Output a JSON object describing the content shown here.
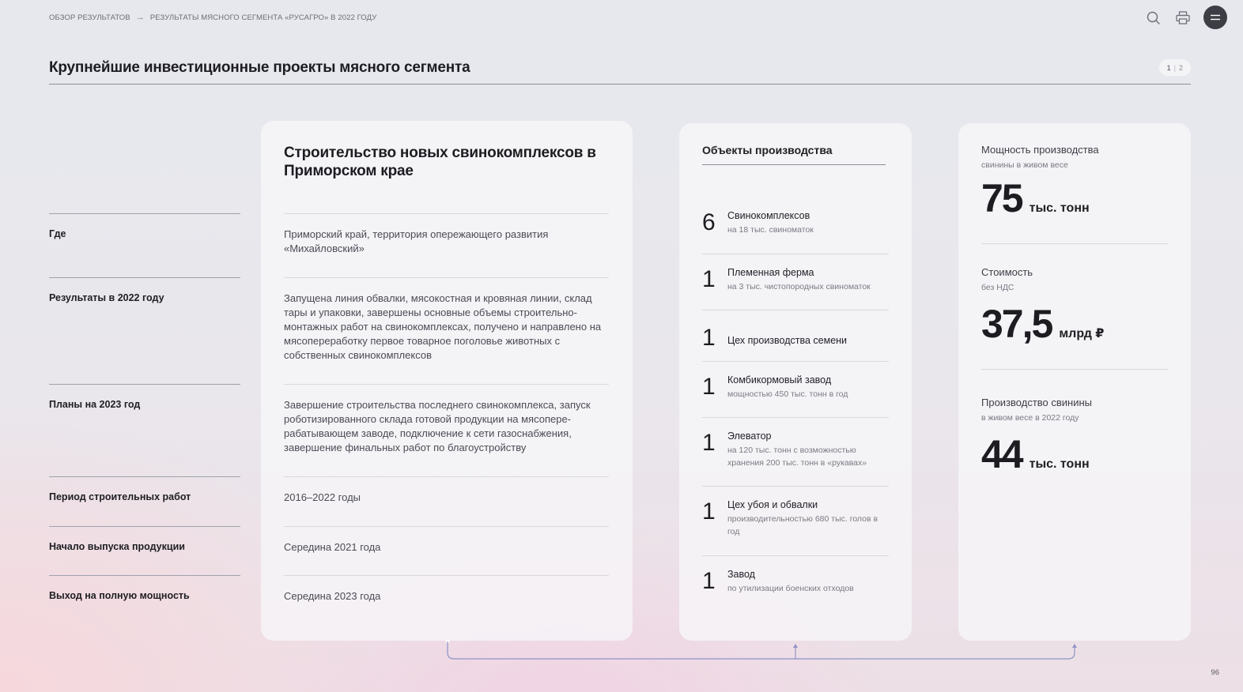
{
  "breadcrumb": {
    "items": [
      "ОБЗОР РЕЗУЛЬТАТОВ",
      "РЕЗУЛЬТАТЫ МЯСНОГО СЕГМЕНТА «РУСАГРО» В 2022 ГОДУ"
    ],
    "separator": "→"
  },
  "header_icons": [
    "search-icon",
    "print-icon",
    "menu-icon"
  ],
  "page_title": "Крупнейшие инвестиционные проекты мясного сегмента",
  "pager": {
    "current": "1",
    "separator": "|",
    "other": "2"
  },
  "labels": [
    "Где",
    "Результаты в 2022 году",
    "Планы на 2023 год",
    "Период строительных работ",
    "Начало выпуска продукции",
    "Выход на полную мощность"
  ],
  "main_card": {
    "title": "Строительство новых свинокомплексов в Приморском крае",
    "rows": [
      "Приморский край, территория опережающего развития «Михайловский»",
      "Запущена линия обвалки, мясокостная и кровяная линии, склад тары и упаковки, завершены основные объемы строительно-монтажных работ на свинокомплексах, получено и направлено на мясопереработку первое товарное поголовье животных с собственных свинокомплексов",
      "Завершение строительства последнего свинокомплекса, запуск роботизированного склада готовой продукции на мясопере-рабатывающем заводе, подключение к сети газоснабжения, завершение финальных работ по благоустройству",
      "2016–2022 годы",
      "Середина 2021 года",
      "Середина 2023 года"
    ]
  },
  "objects_card": {
    "title": "Объекты производства",
    "items": [
      {
        "count": "6",
        "name": "Свинокомплексов",
        "sub": "на 18 тыс. свиноматок"
      },
      {
        "count": "1",
        "name": "Племенная ферма",
        "sub": "на 3 тыс. чистопородных свиноматок"
      },
      {
        "count": "1",
        "name": "Цех производства семени",
        "sub": ""
      },
      {
        "count": "1",
        "name": "Комбикормовый завод",
        "sub": "мощностью 450 тыс. тонн в год"
      },
      {
        "count": "1",
        "name": "Элеватор",
        "sub": "на 120 тыс. тонн с возможностью хранения 200 тыс. тонн в «рукавах»"
      },
      {
        "count": "1",
        "name": "Цех убоя и обвалки",
        "sub": "производительностью 680 тыс. голов в год"
      },
      {
        "count": "1",
        "name": "Завод",
        "sub": "по утилизации боенских отходов"
      }
    ]
  },
  "stats_card": {
    "items": [
      {
        "label": "Мощность производства",
        "sub": "свинины в живом весе",
        "value": "75",
        "unit": "тыс. тонн"
      },
      {
        "label": "Стоимость",
        "sub": "без НДС",
        "value": "37,5",
        "unit": "млрд ₽"
      },
      {
        "label": "Производство свинины",
        "sub": "в живом весе в 2022 году",
        "value": "44",
        "unit": "тыс. тонн"
      }
    ]
  },
  "page_number": "96",
  "colors": {
    "accent_line": "#8f93c6",
    "text_dark": "#1c1c21",
    "muted": "#7a7b84"
  }
}
